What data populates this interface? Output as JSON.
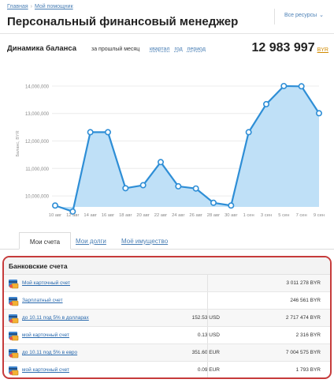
{
  "breadcrumb": {
    "home": "Главная",
    "current": "Мой помощник"
  },
  "resources_label": "Все ресурсы",
  "page_title": "Персональный финансовый менеджер",
  "balance_section": {
    "heading": "Динамика баланса",
    "period_label": "за прошлый месяц",
    "period_links": [
      "квартал",
      "год",
      "период"
    ],
    "total": "12 983 997",
    "currency": "BYR"
  },
  "chart_data": {
    "type": "area",
    "ylabel": "Баланс, BYR",
    "x": [
      "10 авг",
      "12 авг",
      "14 авг",
      "16 авг",
      "18 авг",
      "20 авг",
      "22 авг",
      "24 авг",
      "26 авг",
      "28 авг",
      "30 авг",
      "1 сен",
      "3 сен",
      "5 сен",
      "7 сен",
      "9 сен"
    ],
    "yticks": [
      "10,000,000",
      "11,000,000",
      "12,000,000",
      "13,000,000",
      "14,000,000"
    ],
    "ylim": [
      9600000,
      14200000
    ],
    "points": [
      {
        "x": "10 авг",
        "y": 9650000
      },
      {
        "x": "12 авг",
        "y": 9430000
      },
      {
        "x": "14 авг",
        "y": 12320000
      },
      {
        "x": "16 авг",
        "y": 12320000
      },
      {
        "x": "18 авг",
        "y": 10280000
      },
      {
        "x": "20 авг",
        "y": 10390000
      },
      {
        "x": "22 авг",
        "y": 11230000
      },
      {
        "x": "24 авг",
        "y": 10350000
      },
      {
        "x": "26 авг",
        "y": 10270000
      },
      {
        "x": "28 авг",
        "y": 9750000
      },
      {
        "x": "30 авг",
        "y": 9650000
      },
      {
        "x": "1 сен",
        "y": 12320000
      },
      {
        "x": "3 сен",
        "y": 13340000
      },
      {
        "x": "5 сен",
        "y": 14000000
      },
      {
        "x": "7 сен",
        "y": 13990000
      },
      {
        "x": "9 сен",
        "y": 13010000
      }
    ],
    "grid": true,
    "legend": "none",
    "colors": {
      "line": "#2e8ed6",
      "fill": "#bfe0f7",
      "marker_fill": "#ffffff"
    }
  },
  "tabs": [
    {
      "label": "Мои счета",
      "active": true
    },
    {
      "label": "Мои долги",
      "active": false
    },
    {
      "label": "Моё имущество",
      "active": false
    }
  ],
  "bank_accounts": {
    "heading": "Банковские счета",
    "rows": [
      {
        "name": "Мой карточный счет",
        "foreign": "",
        "amount": "3 011 278 BYR"
      },
      {
        "name": "Зарплатный счет",
        "foreign": "",
        "amount": "246 561 BYR"
      },
      {
        "name": "до 10.11 под 5% в долларах",
        "foreign": "152.53 USD",
        "amount": "2 717 474 BYR"
      },
      {
        "name": "мой карточный счет",
        "foreign": "0.13 USD",
        "amount": "2 316 BYR"
      },
      {
        "name": "до 10.11 под 5% в евро",
        "foreign": "351.60 EUR",
        "amount": "7 004 575 BYR"
      },
      {
        "name": "мой карточный счет",
        "foreign": "0.09 EUR",
        "amount": "1 793 BYR"
      }
    ]
  },
  "colors": {
    "highlight_border": "#c63b3b",
    "link": "#4a7fb5",
    "currency": "#d18a00"
  }
}
